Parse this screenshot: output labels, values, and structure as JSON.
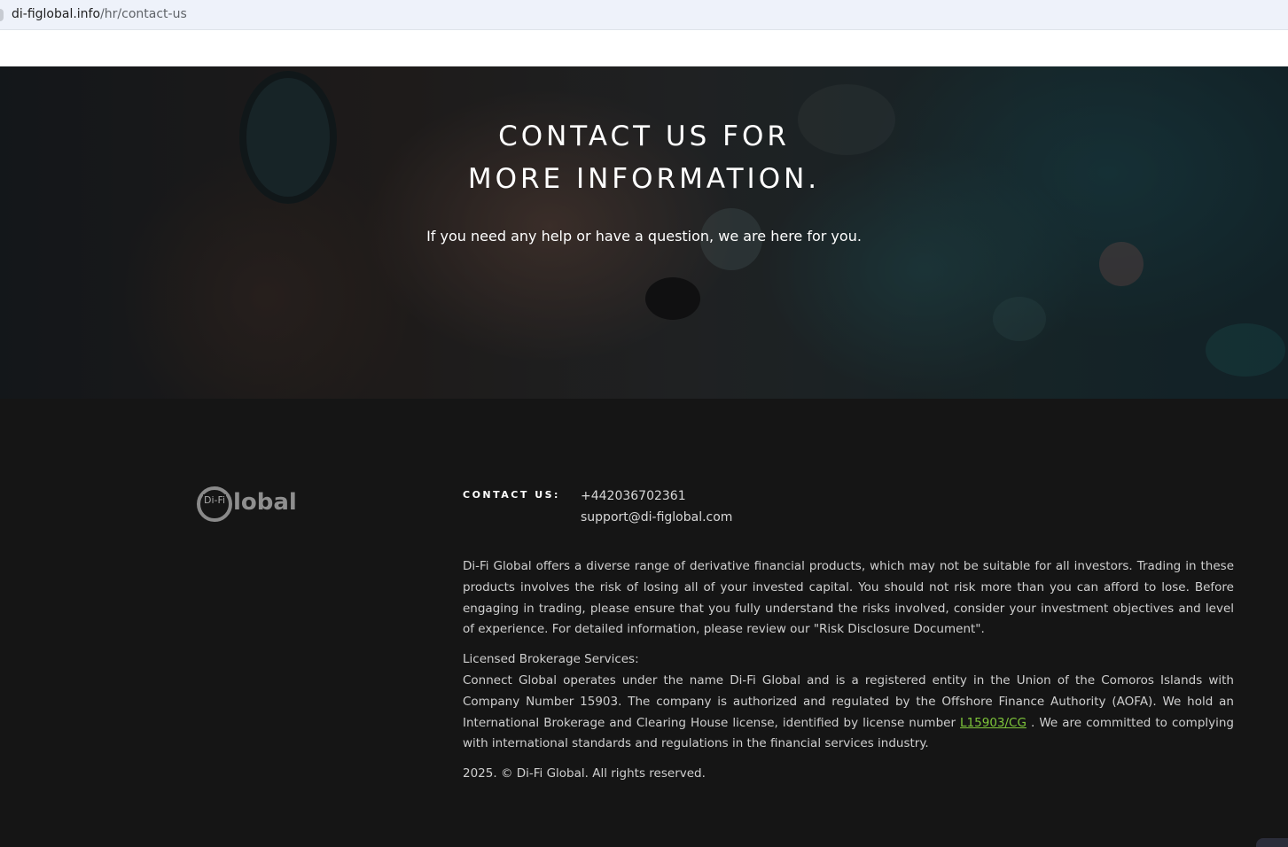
{
  "browser": {
    "url_domain": "di-figlobal.info",
    "url_path": "/hr/contact-us"
  },
  "hero": {
    "title_line1": "CONTACT US FOR",
    "title_line2": "MORE INFORMATION.",
    "subtitle": "If you need any help or have a question, we are here for you."
  },
  "footer": {
    "logo": {
      "badge_text": "Di-Fi",
      "wordmark": "lobal"
    },
    "contact": {
      "label": "CONTACT US:",
      "phone": "+442036702361",
      "email": "support@di-figlobal.com"
    },
    "disclaimer": "Di-Fi Global offers a diverse range of derivative financial products, which may not be suitable for all investors. Trading in these products involves the risk of losing all of your invested capital. You should not risk more than you can afford to lose. Before engaging in trading, please ensure that you fully understand the risks involved, consider your investment objectives and level of experience. For detailed information, please review our \"Risk Disclosure Document\".",
    "licensed_heading": "Licensed Brokerage Services:",
    "licensed_text_before": "Connect Global operates under the name Di-Fi Global and is a registered entity in the Union of the Comoros Islands with Company Number 15903. The company is authorized and regulated by the Offshore Finance Authority (AOFA). We hold an International Brokerage and Clearing House license, identified by license number ",
    "license_number": "L15903/CG",
    "licensed_text_after": " . We are committed to complying with international standards and regulations in the financial services industry.",
    "copyright": "2025. © Di-Fi Global. All rights reserved."
  },
  "colors": {
    "footer_bg": "#151515",
    "link_green": "#7ec63a",
    "address_bar_bg": "#eef2fa"
  }
}
